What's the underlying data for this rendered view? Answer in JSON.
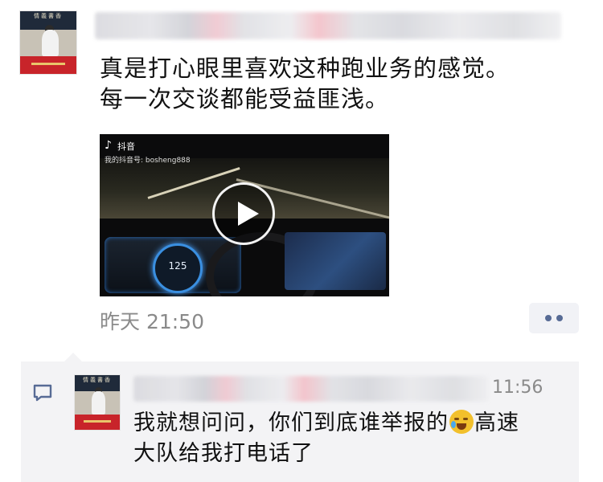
{
  "post": {
    "avatar_caption": "情義書香",
    "text_line1": "真是打心眼里喜欢这种跑业务的感觉。",
    "text_line2": "每一次交谈都能受益匪浅。",
    "video": {
      "watermark_app": "抖音",
      "watermark_id": "我的抖音号: bosheng888",
      "speed": "125"
    },
    "time": "昨天 21:50",
    "more_icon": "ellipsis-icon"
  },
  "comment": {
    "avatar_caption": "情義書香",
    "time": "11:56",
    "text_part1": "我就想问问，你们到底谁举报的",
    "emoji": "crying-face-emoji",
    "text_part2": "高速",
    "text_line2": "大队给我打电话了",
    "icon": "comment-icon"
  },
  "colors": {
    "link": "#576b95",
    "time_gray": "#8a8a8a",
    "comment_bg": "#f3f3f5"
  }
}
